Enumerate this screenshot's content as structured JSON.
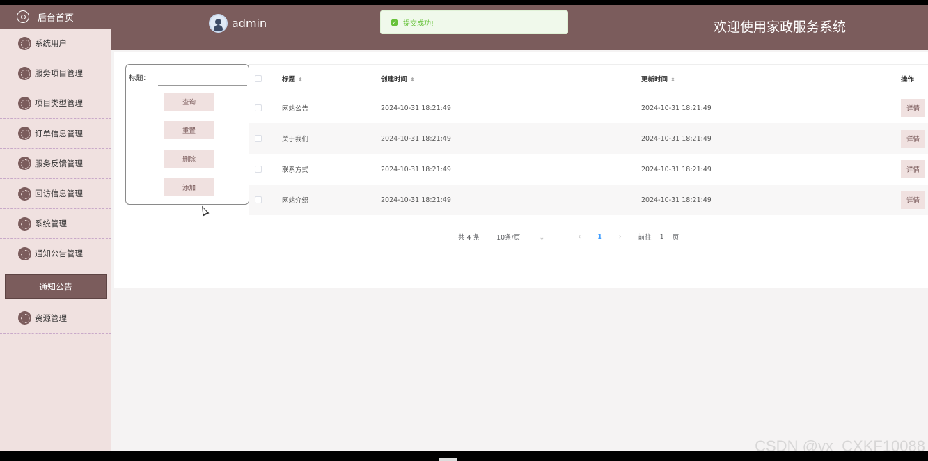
{
  "sidebar": {
    "home_label": "后台首页",
    "items": [
      {
        "label": "系统用户"
      },
      {
        "label": "服务项目管理"
      },
      {
        "label": "项目类型管理"
      },
      {
        "label": "订单信息管理"
      },
      {
        "label": "服务反馈管理"
      },
      {
        "label": "回访信息管理"
      },
      {
        "label": "系统管理"
      },
      {
        "label": "通知公告管理"
      }
    ],
    "active_sub": "通知公告",
    "last_item": "资源管理"
  },
  "header": {
    "username": "admin",
    "toast": "提交成功!",
    "system_title": "欢迎使用家政服务系统"
  },
  "search": {
    "label": "标题:",
    "input_value": "",
    "buttons": {
      "query": "查询",
      "reset": "重置",
      "delete": "删除",
      "add": "添加"
    }
  },
  "table": {
    "headers": {
      "title": "标题",
      "created": "创建时间",
      "updated": "更新时间",
      "action": "操作"
    },
    "rows": [
      {
        "title": "网站公告",
        "created": "2024-10-31 18:21:49",
        "updated": "2024-10-31 18:21:49",
        "action": "详情"
      },
      {
        "title": "关于我们",
        "created": "2024-10-31 18:21:49",
        "updated": "2024-10-31 18:21:49",
        "action": "详情"
      },
      {
        "title": "联系方式",
        "created": "2024-10-31 18:21:49",
        "updated": "2024-10-31 18:21:49",
        "action": "详情"
      },
      {
        "title": "网站介绍",
        "created": "2024-10-31 18:21:49",
        "updated": "2024-10-31 18:21:49",
        "action": "详情"
      }
    ]
  },
  "pagination": {
    "total": "共 4 条",
    "page_size": "10条/页",
    "current": "1",
    "goto_prefix": "前往",
    "goto_value": "1",
    "goto_suffix": "页"
  },
  "watermark": "CSDN @vx_CXKF10088",
  "colors": {
    "brand": "#7b5c5c",
    "sidebar_bg": "#f0e1e0",
    "success": "#67c23a",
    "link": "#409eff"
  }
}
